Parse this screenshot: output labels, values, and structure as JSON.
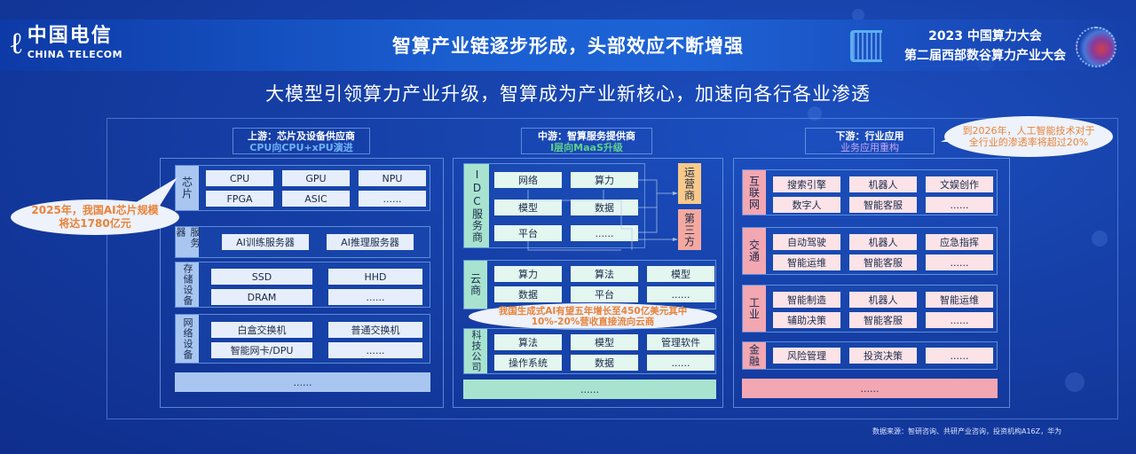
{
  "header": {
    "logo_cn": "中国电信",
    "logo_en": "CHINA TELECOM",
    "title": "智算产业链逐步形成，头部效应不断增强",
    "conference_line1": "2023 中国算力大会",
    "conference_line2": "第二届西部数谷算力产业大会"
  },
  "subtitle": "大模型引领算力产业升级，智算成为产业新核心，加速向各行各业渗透",
  "upstream": {
    "title": "上游：芯片及设备供应商",
    "subtitle": "CPU向CPU+xPU演进",
    "subtitle_color": "#6fb2f5",
    "groups": [
      {
        "label": "芯片",
        "items": [
          "CPU",
          "GPU",
          "NPU",
          "FPGA",
          "ASIC",
          "......"
        ]
      },
      {
        "label": "服务器",
        "items": [
          "AI训练服务器",
          "AI推理服务器"
        ]
      },
      {
        "label": "存储设备",
        "items": [
          "SSD",
          "HHD",
          "DRAM",
          "......"
        ]
      },
      {
        "label": "网络设备",
        "items": [
          "白盒交换机",
          "普通交换机",
          "智能网卡/DPU",
          "......"
        ]
      }
    ],
    "more": "......",
    "callout": "2025年，我国AI芯片规模将达1780亿元"
  },
  "midstream": {
    "title": "中游：智算服务提供商",
    "subtitle": "I层向MaaS升级",
    "subtitle_color": "#5fd18a",
    "groups": [
      {
        "label": "IDC服务商",
        "items": [
          "网络",
          "算力",
          "模型",
          "数据",
          "平台",
          "......"
        ]
      },
      {
        "label": "云商",
        "items": [
          "算力",
          "算法",
          "模型",
          "数据",
          "平台",
          "......"
        ]
      },
      {
        "label": "科技公司",
        "items": [
          "算法",
          "模型",
          "管理软件",
          "操作系统",
          "数据",
          "......"
        ]
      }
    ],
    "targets": [
      {
        "label": "运营商",
        "color": "#f7c98a"
      },
      {
        "label": "第三方",
        "color": "#f4a9a0"
      }
    ],
    "more": "......",
    "callout": "我国生成式AI有望五年增长至450亿美元其中10%-20%营收直接流向云商"
  },
  "downstream": {
    "title": "下游：行业应用",
    "subtitle": "业务应用重构",
    "subtitle_color": "#c4a8f0",
    "groups": [
      {
        "label": "互联网",
        "items": [
          "搜索引擎",
          "机器人",
          "文娱创作",
          "数字人",
          "智能客服",
          "......"
        ]
      },
      {
        "label": "交通",
        "items": [
          "自动驾驶",
          "机器人",
          "应急指挥",
          "智能运维",
          "智能客服",
          "......"
        ]
      },
      {
        "label": "工业",
        "items": [
          "智能制造",
          "机器人",
          "智能运维",
          "辅助决策",
          "智能客服",
          "......"
        ]
      },
      {
        "label": "金融",
        "items": [
          "风险管理",
          "投资决策",
          "......"
        ]
      }
    ],
    "more": "......",
    "callout": "到2026年，人工智能技术对于全行业的渗透率将超过20%"
  },
  "callout_text_color": "#e8833a",
  "source": "数据来源：智研咨询、共研产业咨询，投资机构A16Z，华为"
}
